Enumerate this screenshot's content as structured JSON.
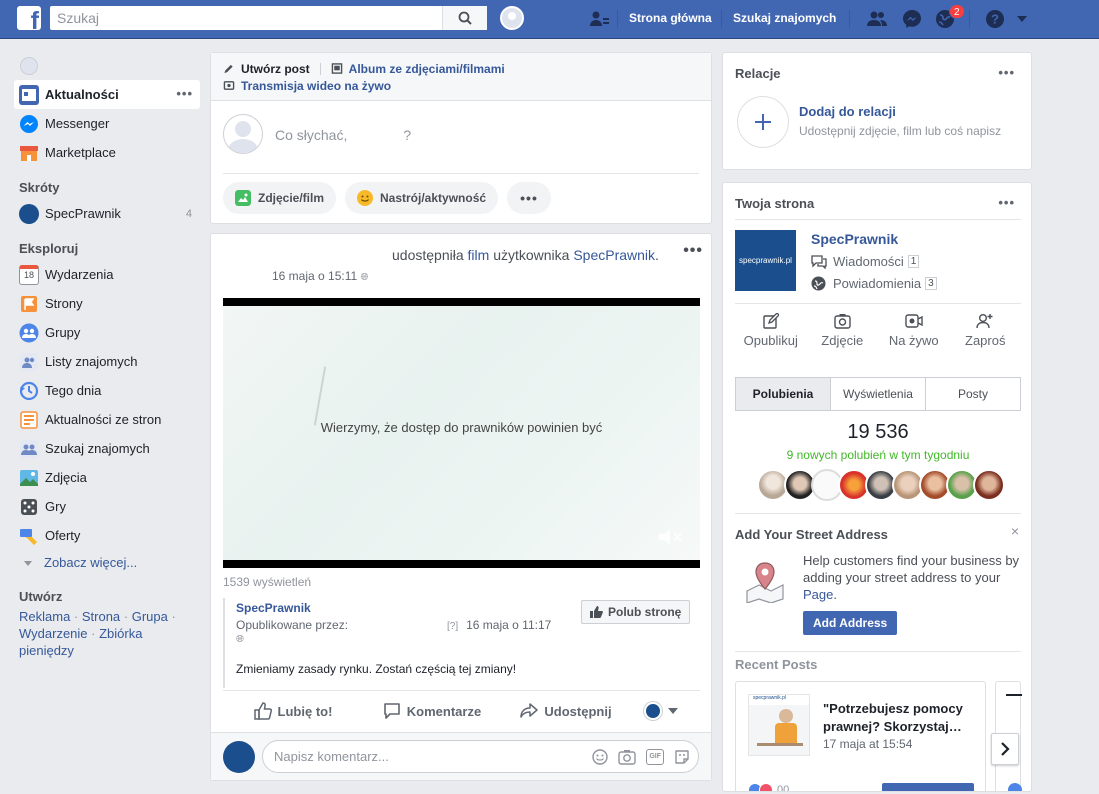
{
  "topbar": {
    "search_placeholder": "Szukaj",
    "home_link": "Strona główna",
    "find_friends_link": "Szukaj znajomych",
    "notif_count": "2"
  },
  "left_nav": {
    "main_items": [
      {
        "label": "Aktualności"
      },
      {
        "label": "Messenger"
      },
      {
        "label": "Marketplace"
      }
    ],
    "shortcuts_title": "Skróty",
    "shortcut": {
      "label": "SpecPrawnik",
      "count": "4"
    },
    "explore_title": "Eksploruj",
    "explore_items": [
      {
        "label": "Wydarzenia",
        "icon_text": "18"
      },
      {
        "label": "Strony"
      },
      {
        "label": "Grupy"
      },
      {
        "label": "Listy znajomych"
      },
      {
        "label": "Tego dnia"
      },
      {
        "label": "Aktualności ze stron"
      },
      {
        "label": "Szukaj znajomych"
      },
      {
        "label": "Zdjęcia"
      },
      {
        "label": "Gry"
      },
      {
        "label": "Oferty"
      }
    ],
    "see_more": "Zobacz więcej...",
    "create_title": "Utwórz",
    "create_links": [
      "Reklama",
      "Strona",
      "Grupa",
      "Wydarzenie",
      "Zbiórka pieniędzy"
    ]
  },
  "composer": {
    "create_post": "Utwórz post",
    "album": "Album ze zdjęciami/filmami",
    "live": "Transmisja wideo na żywo",
    "placeholder": "Co słychać,",
    "placeholder_end": "?",
    "photo_btn": "Zdjęcie/film",
    "mood_btn": "Nastrój/aktywność"
  },
  "post": {
    "shared_prefix": "udostępniła",
    "shared_link": "film",
    "shared_mid": "użytkownika",
    "page_link": "SpecPrawnik",
    "shared_end": ".",
    "time": "16 maja o 15:11",
    "video_text": "Wierzymy, że dostęp do prawników powinien być",
    "views": "1539 wyświetleń",
    "sponsor_name": "SpecPrawnik",
    "published_by": "Opublikowane przez:",
    "published_q": "[?]",
    "published_time": "16 maja o 11:17",
    "like_page": "Polub stronę",
    "sponsor_text": "Zmieniamy zasady rynku. Zostań częścią tej zmiany!",
    "like": "Lubię to!",
    "comment": "Komentarze",
    "share": "Udostępnij",
    "comment_placeholder": "Napisz komentarz...",
    "gif_label": "GIF"
  },
  "relacje": {
    "title": "Relacje",
    "add": "Dodaj do relacji",
    "sub": "Udostępnij zdjęcie, film lub coś napisz"
  },
  "twoja": {
    "title": "Twoja strona",
    "page_name": "SpecPrawnik",
    "logo_text": "specprawnik.pl",
    "messages": "Wiadomości",
    "messages_count": "1",
    "notifications": "Powiadomienia",
    "notifications_count": "3",
    "tools": [
      "Opublikuj",
      "Zdjęcie",
      "Na żywo",
      "Zaproś"
    ],
    "tabs": [
      "Polubienia",
      "Wyświetlenia",
      "Posty"
    ],
    "likes": "19 536",
    "new_likes": "9 nowych polubień w tym tygodniu",
    "address_title": "Add Your Street Address",
    "address_text_1": "Help customers find your business by adding your street address to your",
    "address_link": "Page",
    "address_end": ".",
    "address_btn": "Add Address",
    "recent_title": "Recent Posts",
    "recent_head": "\"Potrzebujesz pomocy prawnej? Skorzystaj…",
    "recent_date": "17 maja at 15:54",
    "recent_thumb": "specprawnik.pl",
    "recent_count": "00"
  },
  "colors": {
    "brand": "#4267b2",
    "link": "#365899",
    "green": "#42b72a",
    "page_logo": "#1a4e8c"
  }
}
